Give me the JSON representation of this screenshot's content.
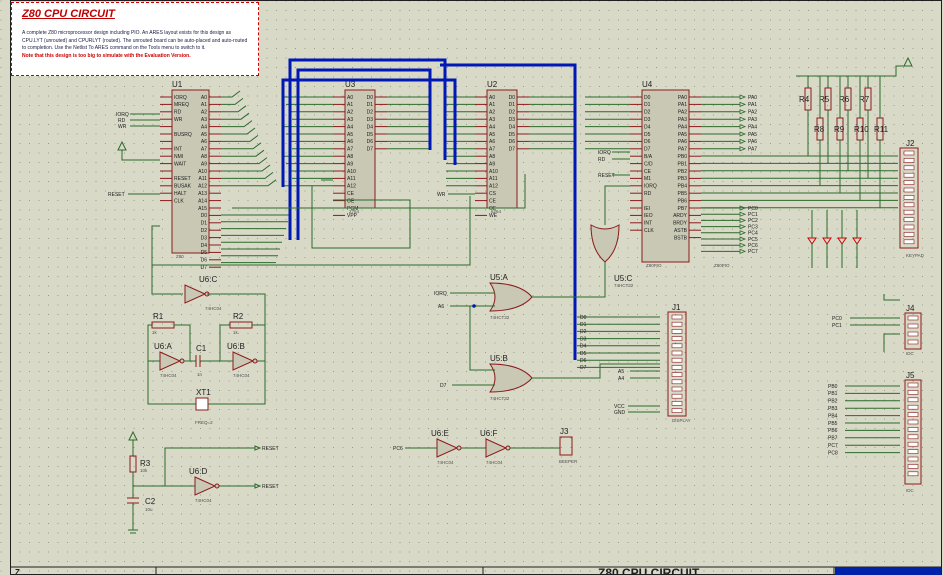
{
  "info": {
    "title": "Z80 CPU CIRCUIT",
    "description": "A complete Z80 microprocessor design including PIO. An ARES layout exists for this design as CPU.LYT (unrouted) and CPURLYT (routed). The unrouted board can be auto-placed and auto-routed to completion. Use the Netlist To ARES command on the Tools menu to switch to it.",
    "note": "Note that this design is too big to simulate with the Evaluation Version."
  },
  "title_block": {
    "title": "Z80 CPU CIRCUIT",
    "left_label": "Z"
  },
  "components": {
    "U1": {
      "ref": "U1",
      "value": "Z80"
    },
    "U2": {
      "ref": "U2",
      "value": "6264"
    },
    "U3": {
      "ref": "U3",
      "value": "2764"
    },
    "U4": {
      "ref": "U4",
      "value": "Z80PIO"
    },
    "U5A": {
      "ref": "U5:A",
      "value": "74HCT32"
    },
    "U5B": {
      "ref": "U5:B",
      "value": "74HCT32"
    },
    "U5C": {
      "ref": "U5:C",
      "value": "74HCT32"
    },
    "U6A": {
      "ref": "U6:A",
      "value": "74HC04"
    },
    "U6B": {
      "ref": "U6:B",
      "value": "74HC04"
    },
    "U6C": {
      "ref": "U6:C",
      "value": "74HC04"
    },
    "U6D": {
      "ref": "U6:D",
      "value": "74HC04"
    },
    "U6E": {
      "ref": "U6:E",
      "value": "74HC04"
    },
    "U6F": {
      "ref": "U6:F",
      "value": "74HC04"
    },
    "R1": {
      "ref": "R1",
      "value": "1k"
    },
    "R2": {
      "ref": "R2",
      "value": "1k"
    },
    "R3": {
      "ref": "R3",
      "value": "10k"
    },
    "C1": {
      "ref": "C1",
      "value": "1n"
    },
    "C2": {
      "ref": "C2",
      "value": "10u"
    },
    "XT1": {
      "ref": "XT1",
      "value": "FREQ=2"
    },
    "J1": {
      "ref": "J1",
      "value": "DISPLAY"
    },
    "J2": {
      "ref": "J2",
      "value": "KEYPAD"
    },
    "J3": {
      "ref": "J3",
      "value": "BEEPER"
    },
    "J4": {
      "ref": "J4",
      "value": "IDC"
    },
    "J5": {
      "ref": "J5",
      "value": "IDC"
    },
    "R4": {
      "ref": "R4",
      "value": "10k"
    },
    "R5": {
      "ref": "R5",
      "value": "10k"
    },
    "R6": {
      "ref": "R6",
      "value": "10k"
    },
    "R7": {
      "ref": "R7",
      "value": "10k"
    },
    "R8": {
      "ref": "R8",
      "value": "10k"
    },
    "R9": {
      "ref": "R9",
      "value": "10k"
    },
    "R10": {
      "ref": "R10",
      "value": "10k"
    },
    "R11": {
      "ref": "R11",
      "value": "10k"
    }
  },
  "nets": {
    "iorq": "IORQ",
    "rd": "RD",
    "wr": "WR",
    "reset": "RESET",
    "a6": "A6",
    "d7": "D7",
    "pc6": "PC6",
    "pc0": "PC0",
    "pc1": "PC1",
    "a5": "A5",
    "a4": "A4",
    "vcc": "VCC",
    "gnd": "GND"
  },
  "pins": {
    "u1_left": [
      "IORQ",
      "MREQ",
      "RD",
      "WR",
      "",
      "BUSRQ",
      "",
      "INT",
      "NMI",
      "WAIT",
      "",
      "RESET",
      "BUSAK",
      "HALT",
      "CLK"
    ],
    "u1_right": [
      "A0",
      "A1",
      "A2",
      "A3",
      "A4",
      "A5",
      "A6",
      "A7",
      "A8",
      "A9",
      "A10",
      "A11",
      "A12",
      "A13",
      "A14",
      "A15",
      "D0",
      "D1",
      "D2",
      "D3",
      "D4",
      "D5",
      "D6",
      "D7"
    ],
    "u3_left": [
      "A0",
      "A1",
      "A2",
      "A3",
      "A4",
      "A5",
      "A6",
      "A7",
      "A8",
      "A9",
      "A10",
      "A11",
      "A12",
      "CE",
      "OE",
      "PGM",
      "VPP"
    ],
    "u3_right": [
      "D0",
      "D1",
      "D2",
      "D3",
      "D4",
      "D5",
      "D6",
      "D7"
    ],
    "u2_left": [
      "A0",
      "A1",
      "A2",
      "A3",
      "A4",
      "A5",
      "A6",
      "A7",
      "A8",
      "A9",
      "A10",
      "A11",
      "A12",
      "CS",
      "CE",
      "OE",
      "WE"
    ],
    "u2_right": [
      "D0",
      "D1",
      "D2",
      "D3",
      "D4",
      "D5",
      "D6",
      "D7"
    ],
    "u4_left": [
      "D0",
      "D1",
      "D2",
      "D3",
      "D4",
      "D5",
      "D6",
      "D7",
      "B/A",
      "C/D",
      "CE",
      "M1",
      "IORQ",
      "RD",
      "",
      "IEI",
      "IEO",
      "INT",
      "CLK"
    ],
    "u4_right": [
      "PA0",
      "PA1",
      "PA2",
      "PA3",
      "PA4",
      "PA5",
      "PA6",
      "PA7",
      "PB0",
      "PB1",
      "PB2",
      "PB3",
      "PB4",
      "PB5",
      "PB6",
      "PB7",
      "ARDY",
      "BRDY",
      "ASTB",
      "BSTB"
    ],
    "pa_labels": [
      "PA0",
      "PA1",
      "PA2",
      "PA3",
      "PA4",
      "PA5",
      "PA6",
      "PA7"
    ],
    "pc_labels": [
      "PC0",
      "PC1",
      "PC2",
      "PC3",
      "PC4",
      "PC5",
      "PC6",
      "PC7"
    ],
    "j5_labels": [
      "PB0",
      "PB1",
      "PB2",
      "PB3",
      "PB4",
      "PB5",
      "PB6",
      "PB7",
      "PC7",
      "PC8"
    ],
    "j1_left": [
      "D0",
      "D1",
      "D2",
      "D3",
      "D4",
      "D5",
      "D6",
      "D7",
      "",
      "",
      "",
      "",
      "",
      "",
      ""
    ]
  }
}
